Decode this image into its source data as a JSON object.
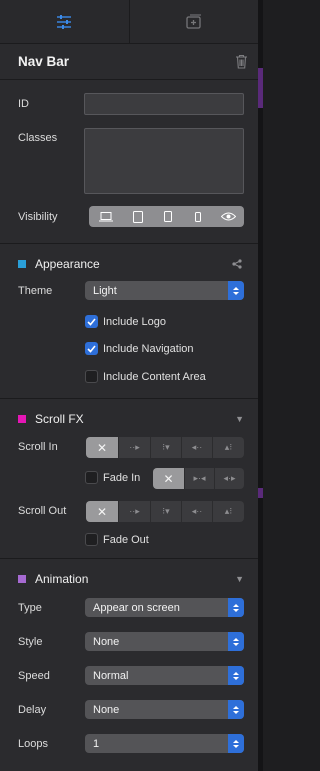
{
  "tabs": {
    "style_icon": "sliders-icon",
    "add_icon": "add-square-icon"
  },
  "header": {
    "title": "Nav Bar",
    "delete_icon": "trash-icon"
  },
  "attributes": {
    "id_label": "ID",
    "id_value": "",
    "classes_label": "Classes",
    "classes_value": "",
    "visibility_label": "Visibility",
    "visibility_options": [
      "desktop-icon",
      "tablet-landscape-icon",
      "tablet-portrait-icon",
      "phone-icon",
      "eye-icon"
    ]
  },
  "appearance": {
    "title": "Appearance",
    "color": "#2a9fd8",
    "share_icon": "share-icon",
    "theme_label": "Theme",
    "theme_value": "Light",
    "include_logo": {
      "label": "Include Logo",
      "checked": true
    },
    "include_navigation": {
      "label": "Include Navigation",
      "checked": true
    },
    "include_content": {
      "label": "Include Content Area",
      "checked": false
    }
  },
  "scroll_fx": {
    "title": "Scroll FX",
    "color": "#e516b5",
    "scroll_in_label": "Scroll In",
    "fade_in_label": "Fade In",
    "scroll_out_label": "Scroll Out",
    "fade_out_label": "Fade Out"
  },
  "animation": {
    "title": "Animation",
    "color": "#a66ad2",
    "type_label": "Type",
    "type_value": "Appear on screen",
    "style_label": "Style",
    "style_value": "None",
    "speed_label": "Speed",
    "speed_value": "Normal",
    "delay_label": "Delay",
    "delay_value": "None",
    "loops_label": "Loops",
    "loops_value": "1"
  },
  "colors": {
    "accent": "#2e6fd9"
  }
}
